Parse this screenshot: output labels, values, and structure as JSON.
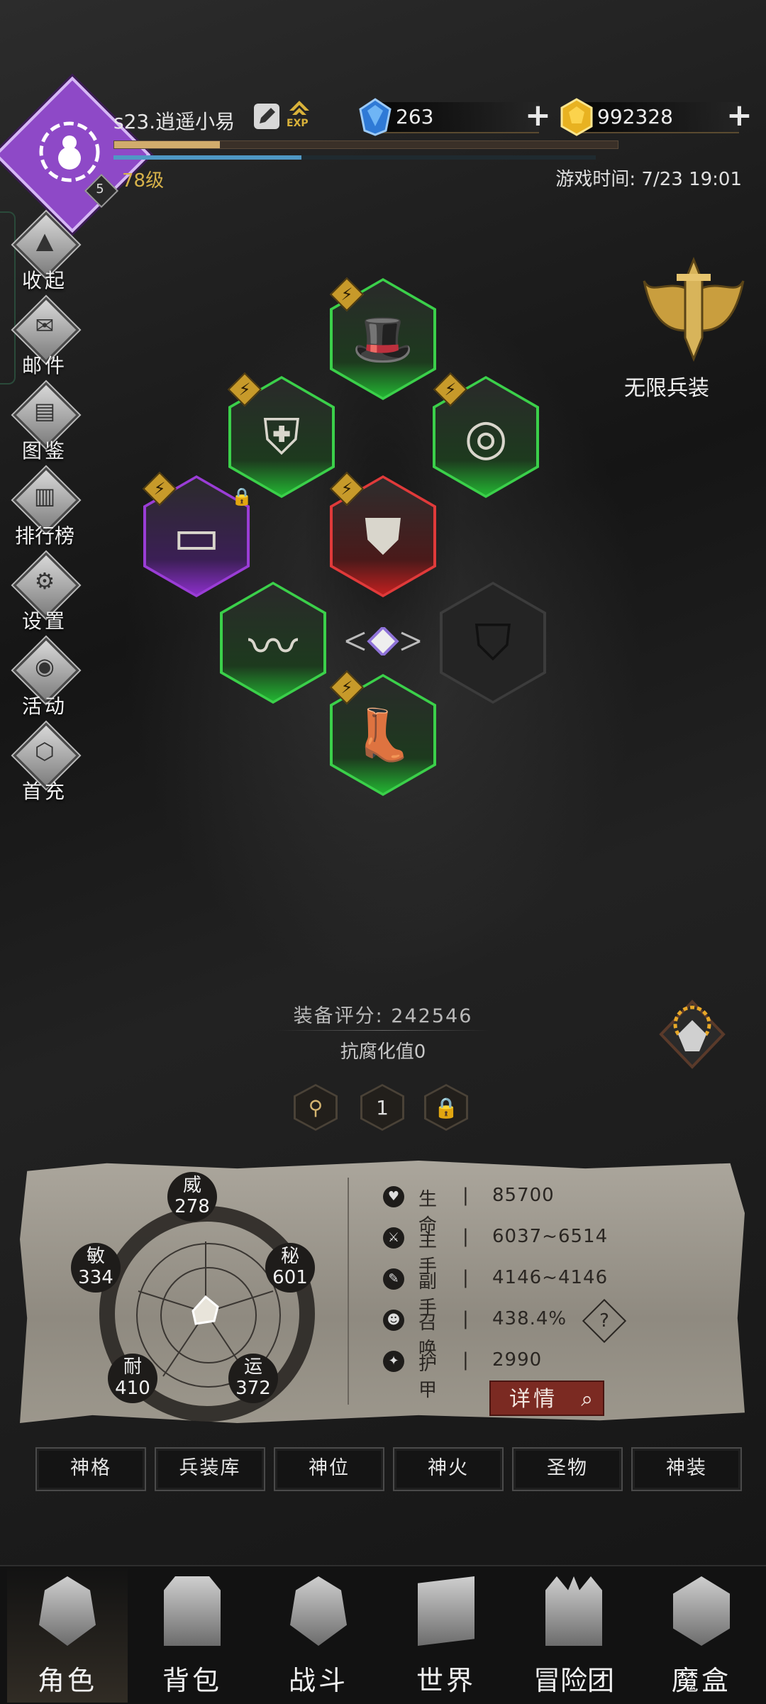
{
  "player": {
    "name": "s23.逍遥小易",
    "level_text": "78级",
    "badge_level": "5",
    "exp_label": "EXP",
    "xp_fraction": 0.21,
    "mp_fraction": 0.39
  },
  "currency": {
    "diamonds": "263",
    "gold": "992328"
  },
  "game_time": "游戏时间: 7/23 19:01",
  "side_menu": [
    {
      "label": "收起",
      "icon": "collapse-icon"
    },
    {
      "label": "邮件",
      "icon": "mail-icon"
    },
    {
      "label": "图鉴",
      "icon": "book-icon"
    },
    {
      "label": "排行榜",
      "icon": "ranking-icon"
    },
    {
      "label": "设置",
      "icon": "gear-icon"
    },
    {
      "label": "活动",
      "icon": "event-icon"
    },
    {
      "label": "首充",
      "icon": "first-recharge-icon"
    }
  ],
  "infinite_gear": "无限兵装",
  "equipment": [
    {
      "slot": "helmet",
      "icon": "hat-icon",
      "rarity": "green"
    },
    {
      "slot": "shoulder",
      "icon": "shoulder-armor-icon",
      "rarity": "green"
    },
    {
      "slot": "ring",
      "icon": "ring-icon",
      "rarity": "green"
    },
    {
      "slot": "belt",
      "icon": "belt-icon",
      "rarity": "purple",
      "locked": true
    },
    {
      "slot": "chest",
      "icon": "chest-armor-icon",
      "rarity": "red"
    },
    {
      "slot": "weapon",
      "icon": "whip-icon",
      "rarity": "green"
    },
    {
      "slot": "offhand",
      "icon": "shield-icon",
      "rarity": "empty"
    },
    {
      "slot": "boots",
      "icon": "boots-icon",
      "rarity": "green"
    }
  ],
  "score_text": "装备评分: 242546",
  "anticorrosion_text": "抗腐化值0",
  "page_selector": {
    "current": "1"
  },
  "stats": {
    "wei": {
      "name": "威",
      "value": "278"
    },
    "mi": {
      "name": "秘",
      "value": "601"
    },
    "yun": {
      "name": "运",
      "value": "372"
    },
    "nai": {
      "name": "耐",
      "value": "410"
    },
    "min": {
      "name": "敏",
      "value": "334"
    }
  },
  "attributes": [
    {
      "label": "生命",
      "value": "85700",
      "icon": "heart-icon"
    },
    {
      "label": "主手",
      "value": "6037~6514",
      "icon": "sword-icon"
    },
    {
      "label": "副手",
      "value": "4146~4146",
      "icon": "dagger-icon"
    },
    {
      "label": "召唤",
      "value": "438.4%",
      "icon": "summon-icon"
    },
    {
      "label": "护甲",
      "value": "2990",
      "icon": "armor-icon"
    }
  ],
  "detail_button": "详情",
  "tabs": [
    "神格",
    "兵装库",
    "神位",
    "神火",
    "圣物",
    "神装"
  ],
  "nav": [
    "角色",
    "背包",
    "战斗",
    "世界",
    "冒险团",
    "魔盒"
  ],
  "colors": {
    "gold": "#d7b24a",
    "green_rarity": "#3bd04a",
    "purple_rarity": "#9a3dd6",
    "red_rarity": "#e03a3a"
  }
}
